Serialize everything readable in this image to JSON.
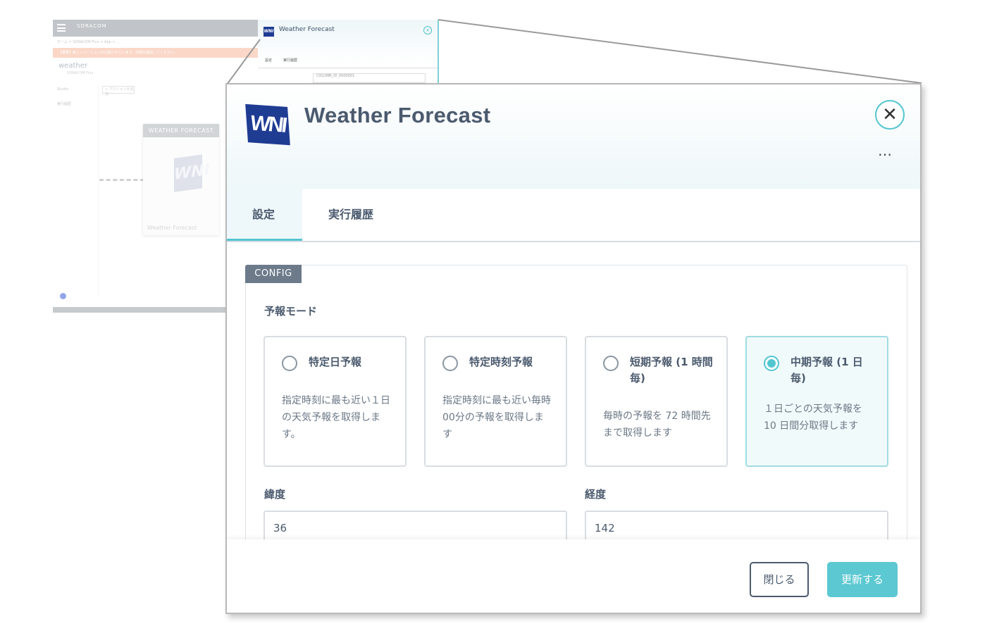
{
  "background_app": {
    "brand": "SORACOM",
    "breadcrumb": "ホーム > SORACOM Flux > App > ...",
    "alert": "【重要】新しいバージョンが公開されています。詳細を確認してください。",
    "title": "weather",
    "subtitle": "SORACOM Flux",
    "left_items": [
      "Studio",
      "実行履歴"
    ],
    "toolbar_button": "+ アクションを追加",
    "card": {
      "header": "WEATHER FORECAST",
      "logo": "WNI",
      "footer": "Weather Forecast"
    }
  },
  "mini_dialog": {
    "title": "Weather Forecast",
    "close_glyph": "×",
    "tabs": [
      "設定",
      "実行履歴"
    ],
    "input_value": "COLUMN_ID_0000001"
  },
  "dialog": {
    "logo_text": "WNI",
    "title": "Weather Forecast",
    "close_glyph": "✕",
    "more_glyph": "…",
    "tabs": [
      {
        "label": "設定",
        "active": true
      },
      {
        "label": "実行履歴",
        "active": false
      }
    ],
    "panel_badge": "CONFIG",
    "mode_label": "予報モード",
    "options": [
      {
        "title": "特定日予報",
        "description": "指定時刻に最も近い１日の天気予報を取得します。",
        "selected": false
      },
      {
        "title": "特定時刻予報",
        "description": "指定時刻に最も近い毎時00分の予報を取得します",
        "selected": false
      },
      {
        "title": "短期予報 (1 時間毎)",
        "description": "毎時の予報を 72 時間先まで取得します",
        "selected": false
      },
      {
        "title": "中期予報 (1 日毎)",
        "description": "１日ごとの天気予報を 10 日間分取得します",
        "selected": true
      }
    ],
    "latitude": {
      "label": "緯度",
      "value": "36"
    },
    "longitude": {
      "label": "経度",
      "value": "142"
    },
    "buttons": {
      "close": "閉じる",
      "update": "更新する"
    }
  },
  "colors": {
    "accent": "#52c6cf",
    "brand_blue": "#1f3c93",
    "text": "#4b5a6e",
    "badge": "#6c7a8a"
  }
}
